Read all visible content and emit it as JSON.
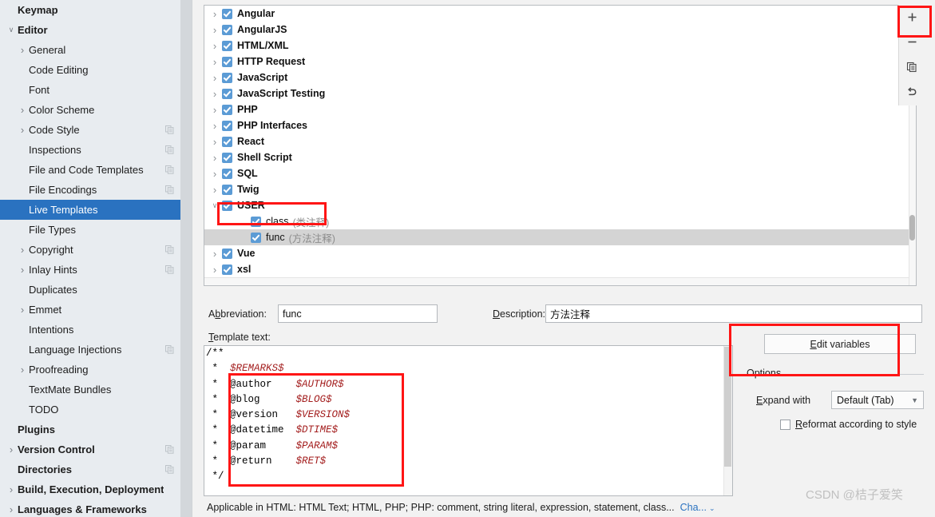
{
  "sidebar": {
    "items": [
      {
        "label": "Keymap",
        "depth": 0,
        "twisty": "",
        "bold": true,
        "selected": false,
        "copy": false
      },
      {
        "label": "Editor",
        "depth": 0,
        "twisty": "v",
        "bold": true,
        "selected": false,
        "copy": false
      },
      {
        "label": "General",
        "depth": 1,
        "twisty": ">",
        "bold": false,
        "selected": false,
        "copy": false
      },
      {
        "label": "Code Editing",
        "depth": 1,
        "twisty": "",
        "bold": false,
        "selected": false,
        "copy": false
      },
      {
        "label": "Font",
        "depth": 1,
        "twisty": "",
        "bold": false,
        "selected": false,
        "copy": false
      },
      {
        "label": "Color Scheme",
        "depth": 1,
        "twisty": ">",
        "bold": false,
        "selected": false,
        "copy": false
      },
      {
        "label": "Code Style",
        "depth": 1,
        "twisty": ">",
        "bold": false,
        "selected": false,
        "copy": true
      },
      {
        "label": "Inspections",
        "depth": 1,
        "twisty": "",
        "bold": false,
        "selected": false,
        "copy": true
      },
      {
        "label": "File and Code Templates",
        "depth": 1,
        "twisty": "",
        "bold": false,
        "selected": false,
        "copy": true
      },
      {
        "label": "File Encodings",
        "depth": 1,
        "twisty": "",
        "bold": false,
        "selected": false,
        "copy": true
      },
      {
        "label": "Live Templates",
        "depth": 1,
        "twisty": "",
        "bold": false,
        "selected": true,
        "copy": false
      },
      {
        "label": "File Types",
        "depth": 1,
        "twisty": "",
        "bold": false,
        "selected": false,
        "copy": false
      },
      {
        "label": "Copyright",
        "depth": 1,
        "twisty": ">",
        "bold": false,
        "selected": false,
        "copy": true
      },
      {
        "label": "Inlay Hints",
        "depth": 1,
        "twisty": ">",
        "bold": false,
        "selected": false,
        "copy": true
      },
      {
        "label": "Duplicates",
        "depth": 1,
        "twisty": "",
        "bold": false,
        "selected": false,
        "copy": false
      },
      {
        "label": "Emmet",
        "depth": 1,
        "twisty": ">",
        "bold": false,
        "selected": false,
        "copy": false
      },
      {
        "label": "Intentions",
        "depth": 1,
        "twisty": "",
        "bold": false,
        "selected": false,
        "copy": false
      },
      {
        "label": "Language Injections",
        "depth": 1,
        "twisty": "",
        "bold": false,
        "selected": false,
        "copy": true
      },
      {
        "label": "Proofreading",
        "depth": 1,
        "twisty": ">",
        "bold": false,
        "selected": false,
        "copy": false
      },
      {
        "label": "TextMate Bundles",
        "depth": 1,
        "twisty": "",
        "bold": false,
        "selected": false,
        "copy": false
      },
      {
        "label": "TODO",
        "depth": 1,
        "twisty": "",
        "bold": false,
        "selected": false,
        "copy": false
      },
      {
        "label": "Plugins",
        "depth": 0,
        "twisty": "",
        "bold": true,
        "selected": false,
        "copy": false
      },
      {
        "label": "Version Control",
        "depth": 0,
        "twisty": ">",
        "bold": true,
        "selected": false,
        "copy": true
      },
      {
        "label": "Directories",
        "depth": 0,
        "twisty": "",
        "bold": true,
        "selected": false,
        "copy": true
      },
      {
        "label": "Build, Execution, Deployment",
        "depth": 0,
        "twisty": ">",
        "bold": true,
        "selected": false,
        "copy": false
      },
      {
        "label": "Languages & Frameworks",
        "depth": 0,
        "twisty": ">",
        "bold": true,
        "selected": false,
        "copy": false
      }
    ]
  },
  "tree": {
    "rows": [
      {
        "label": "Angular",
        "desc": "",
        "twisty": ">",
        "depth": 0,
        "checked": true,
        "selected": false
      },
      {
        "label": "AngularJS",
        "desc": "",
        "twisty": ">",
        "depth": 0,
        "checked": true,
        "selected": false
      },
      {
        "label": "HTML/XML",
        "desc": "",
        "twisty": ">",
        "depth": 0,
        "checked": true,
        "selected": false
      },
      {
        "label": "HTTP Request",
        "desc": "",
        "twisty": ">",
        "depth": 0,
        "checked": true,
        "selected": false
      },
      {
        "label": "JavaScript",
        "desc": "",
        "twisty": ">",
        "depth": 0,
        "checked": true,
        "selected": false
      },
      {
        "label": "JavaScript Testing",
        "desc": "",
        "twisty": ">",
        "depth": 0,
        "checked": true,
        "selected": false
      },
      {
        "label": "PHP",
        "desc": "",
        "twisty": ">",
        "depth": 0,
        "checked": true,
        "selected": false
      },
      {
        "label": "PHP Interfaces",
        "desc": "",
        "twisty": ">",
        "depth": 0,
        "checked": true,
        "selected": false
      },
      {
        "label": "React",
        "desc": "",
        "twisty": ">",
        "depth": 0,
        "checked": true,
        "selected": false
      },
      {
        "label": "Shell Script",
        "desc": "",
        "twisty": ">",
        "depth": 0,
        "checked": true,
        "selected": false
      },
      {
        "label": "SQL",
        "desc": "",
        "twisty": ">",
        "depth": 0,
        "checked": true,
        "selected": false
      },
      {
        "label": "Twig",
        "desc": "",
        "twisty": ">",
        "depth": 0,
        "checked": true,
        "selected": false
      },
      {
        "label": "USER",
        "desc": "",
        "twisty": "v",
        "depth": 0,
        "checked": true,
        "selected": false
      },
      {
        "label": "class",
        "desc": "(类注释)",
        "twisty": "",
        "depth": 1,
        "checked": true,
        "selected": false
      },
      {
        "label": "func",
        "desc": "(方法注释)",
        "twisty": "",
        "depth": 1,
        "checked": true,
        "selected": true
      },
      {
        "label": "Vue",
        "desc": "",
        "twisty": ">",
        "depth": 0,
        "checked": true,
        "selected": false
      },
      {
        "label": "xsl",
        "desc": "",
        "twisty": ">",
        "depth": 0,
        "checked": true,
        "selected": false
      }
    ]
  },
  "toolbar": {
    "add_title": "Add",
    "remove_title": "Remove",
    "duplicate_title": "Duplicate",
    "revert_title": "Revert"
  },
  "form": {
    "abbreviation_label_pre": "A",
    "abbreviation_label_key": "b",
    "abbreviation_label_post": "breviation:",
    "abbreviation_value": "func",
    "description_label_pre": "",
    "description_label_key": "D",
    "description_label_post": "escription:",
    "description_value": "方法注释",
    "template_text_label_key": "T",
    "template_text_label_post": "emplate text:"
  },
  "template_code": {
    "lines": [
      [
        {
          "t": "/**",
          "v": false
        }
      ],
      [
        {
          "t": " *  ",
          "v": false
        },
        {
          "t": "$REMARKS$",
          "v": true
        }
      ],
      [
        {
          "t": " *  @author    ",
          "v": false
        },
        {
          "t": "$AUTHOR$",
          "v": true
        }
      ],
      [
        {
          "t": " *  @blog      ",
          "v": false
        },
        {
          "t": "$BLOG$",
          "v": true
        }
      ],
      [
        {
          "t": " *  @version   ",
          "v": false
        },
        {
          "t": "$VERSION$",
          "v": true
        }
      ],
      [
        {
          "t": " *  @datetime  ",
          "v": false
        },
        {
          "t": "$DTIME$",
          "v": true
        }
      ],
      [
        {
          "t": " *  @param     ",
          "v": false
        },
        {
          "t": "$PARAM$",
          "v": true
        }
      ],
      [
        {
          "t": " *  @return    ",
          "v": false
        },
        {
          "t": "$RET$",
          "v": true
        }
      ],
      [
        {
          "t": " */",
          "v": false
        }
      ]
    ]
  },
  "options": {
    "edit_variables_key": "E",
    "edit_variables_rest": "dit variables",
    "legend": "Options",
    "expand_with_key": "E",
    "expand_with_pre": "",
    "expand_with_rest": "xpand with",
    "expand_with_value": "Default (Tab)",
    "expand_with_caret": "▼",
    "reformat_key": "R",
    "reformat_rest": "eformat according to style",
    "reformat_checked": false
  },
  "status": {
    "applicable_text": "Applicable in HTML: HTML Text; HTML, PHP; PHP: comment, string literal, expression, statement, class...",
    "change_link": "Cha...",
    "change_caret": "⌄"
  },
  "watermark": {
    "text": "CSDN @桔子爱笑"
  },
  "colors": {
    "sidebar_bg": "#e8ecf0",
    "selection_blue": "#2a72c0",
    "checkbox_blue": "#5b9bd5",
    "annotation_red": "#ff1515",
    "variable_red": "#a42020",
    "row_selected_gray": "#d4d4d4"
  }
}
